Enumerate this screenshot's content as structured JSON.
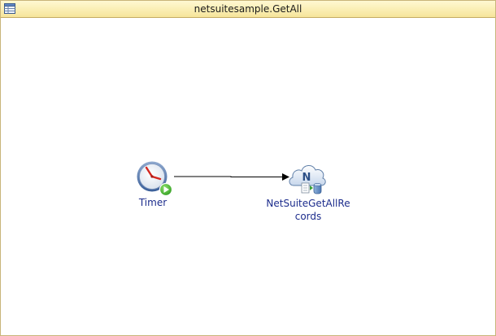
{
  "window": {
    "title": "netsuitesample.GetAll",
    "icon": "table-icon"
  },
  "diagram": {
    "nodes": [
      {
        "id": "timer",
        "label": "Timer",
        "icon": "clock-play-icon"
      },
      {
        "id": "netsuite",
        "label": "NetSuiteGetAllRecords",
        "icon": "netsuite-cloud-icon"
      }
    ],
    "connections": [
      {
        "from": "timer",
        "to": "netsuite"
      }
    ]
  },
  "colors": {
    "titlebar": "#f6e59a",
    "label": "#1c2c8c",
    "connector": "#000000"
  }
}
